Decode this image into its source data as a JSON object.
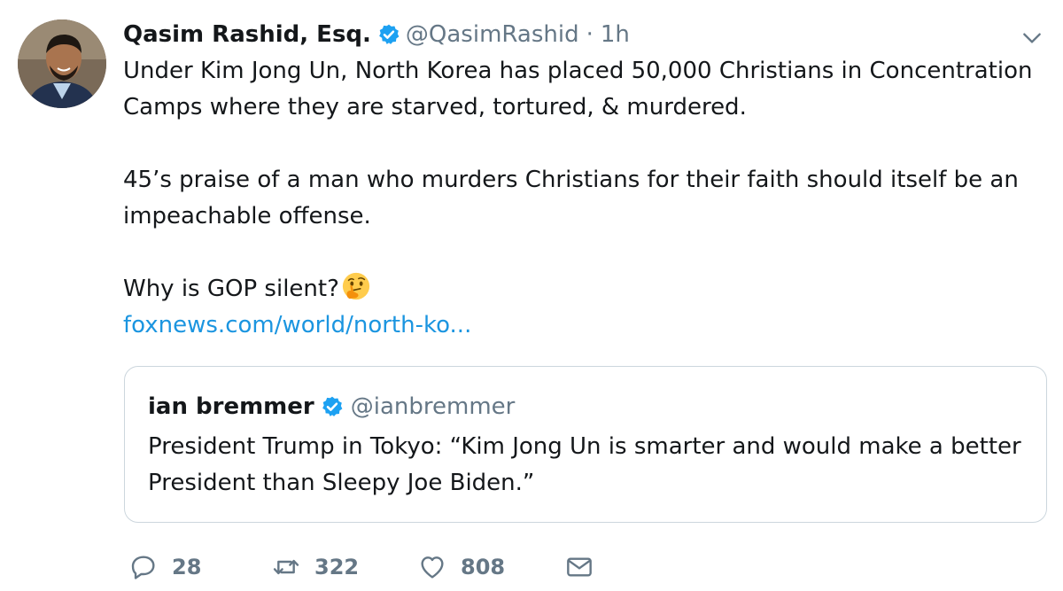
{
  "author": {
    "name": "Qasim Rashid, Esq.",
    "handle": "@QasimRashid",
    "separator": "·",
    "time": "1h",
    "avatar_icon": "avatar-photo"
  },
  "tweet": {
    "para1": "Under Kim Jong Un, North Korea has placed 50,000 Christians in Concentration Camps where they are starved, tortured, & murdered.",
    "para2": "45’s praise of a man who murders Christians for their faith should itself be an impeachable offense.",
    "para3": "Why is GOP silent?",
    "emoji": "thinking-face-emoji",
    "link": "foxnews.com/world/north-ko..."
  },
  "quoted": {
    "name": "ian bremmer",
    "handle": "@ianbremmer",
    "text": "President Trump in Tokyo: “Kim Jong Un is smarter and would make a better President than Sleepy Joe Biden.”"
  },
  "actions": {
    "replies": "28",
    "retweets": "322",
    "likes": "808"
  },
  "colors": {
    "verified": "#1da1f2",
    "link": "#1b95e0",
    "muted": "#657786",
    "border": "#ccd6dd"
  }
}
